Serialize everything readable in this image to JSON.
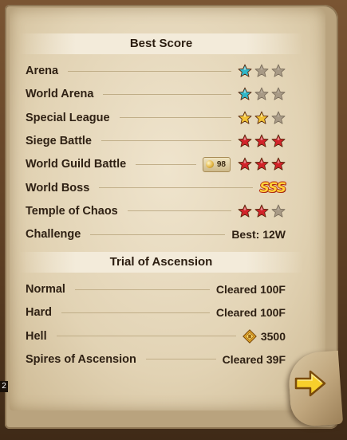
{
  "best_score": {
    "title": "Best Score",
    "rows": [
      {
        "label": "Arena",
        "stars": [
          "teal",
          "grey",
          "grey"
        ]
      },
      {
        "label": "World Arena",
        "stars": [
          "teal",
          "grey",
          "grey"
        ]
      },
      {
        "label": "Special League",
        "stars": [
          "gold",
          "gold",
          "grey"
        ]
      },
      {
        "label": "Siege Battle",
        "stars": [
          "red",
          "red",
          "red"
        ]
      },
      {
        "label": "World Guild Battle",
        "badge": "98",
        "stars": [
          "red",
          "red",
          "red"
        ]
      },
      {
        "label": "World Boss",
        "grade": "SSS"
      },
      {
        "label": "Temple of Chaos",
        "stars": [
          "red",
          "red",
          "grey"
        ]
      },
      {
        "label": "Challenge",
        "value": "Best: 12W"
      }
    ]
  },
  "trial": {
    "title": "Trial of Ascension",
    "rows": [
      {
        "label": "Normal",
        "value": "Cleared 100F"
      },
      {
        "label": "Hard",
        "value": "Cleared 100F"
      },
      {
        "label": "Hell",
        "value": "3500",
        "icon": "gold-medal-icon"
      },
      {
        "label": "Spires of Ascension",
        "value": "Cleared 39F"
      }
    ]
  },
  "page_number": "2",
  "colors": {
    "teal": "#2fb6c8",
    "gold": "#f2c235",
    "red": "#d2232a",
    "grey": "#a89a86"
  }
}
